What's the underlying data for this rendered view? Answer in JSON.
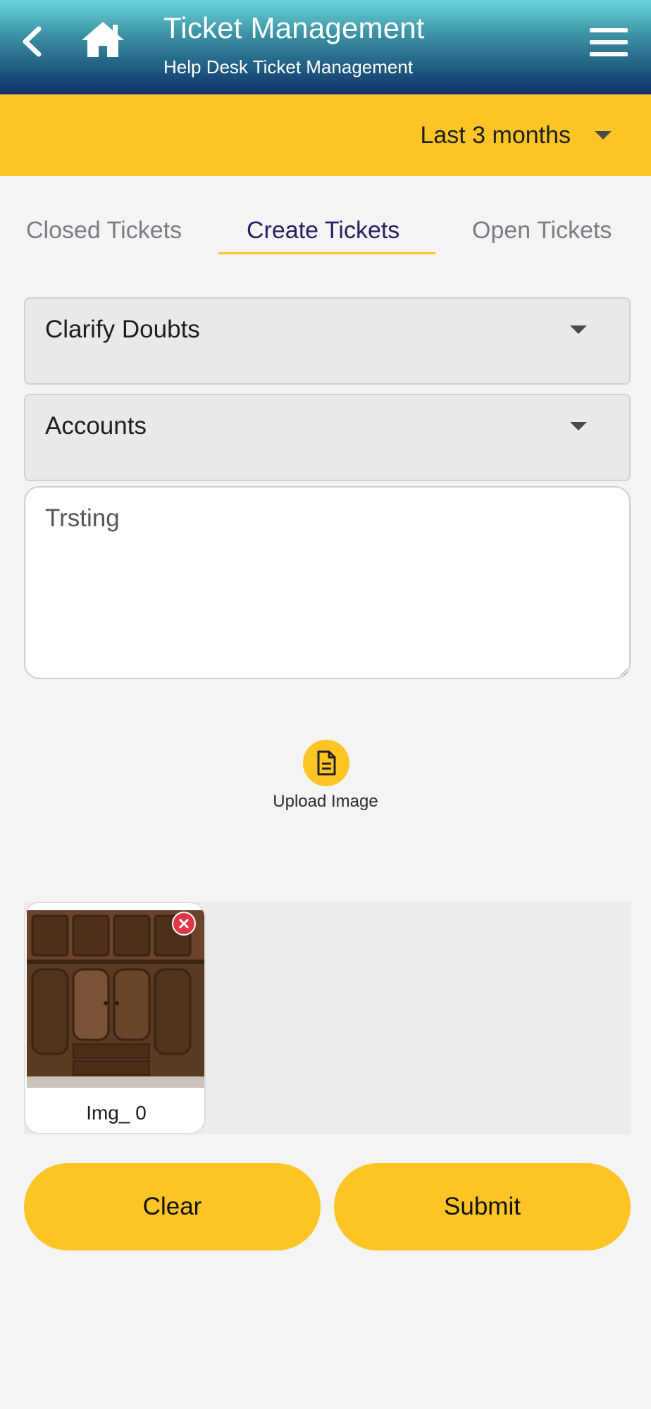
{
  "header": {
    "title": "Ticket Management",
    "subtitle": "Help Desk Ticket Management",
    "back_icon": "chevron-left-icon",
    "home_icon": "home-icon",
    "menu_icon": "hamburger-menu-icon"
  },
  "period": {
    "selected": "Last 3 months"
  },
  "tabs": [
    {
      "label": "Closed Tickets",
      "active": false
    },
    {
      "label": "Create Tickets",
      "active": true
    },
    {
      "label": "Open Tickets",
      "active": false
    }
  ],
  "form": {
    "ticket_type": "Clarify Doubts",
    "department": "Accounts",
    "description": "Trsting"
  },
  "upload": {
    "label": "Upload Image",
    "icon": "document-icon"
  },
  "attachments": [
    {
      "label": "Img_ 0"
    }
  ],
  "actions": {
    "clear_label": "Clear",
    "submit_label": "Submit"
  },
  "colors": {
    "accent": "#fdc425",
    "header_top": "#6ad6dc",
    "header_bottom": "#0f2f68",
    "active_tab": "#262262",
    "remove": "#e0364a"
  }
}
